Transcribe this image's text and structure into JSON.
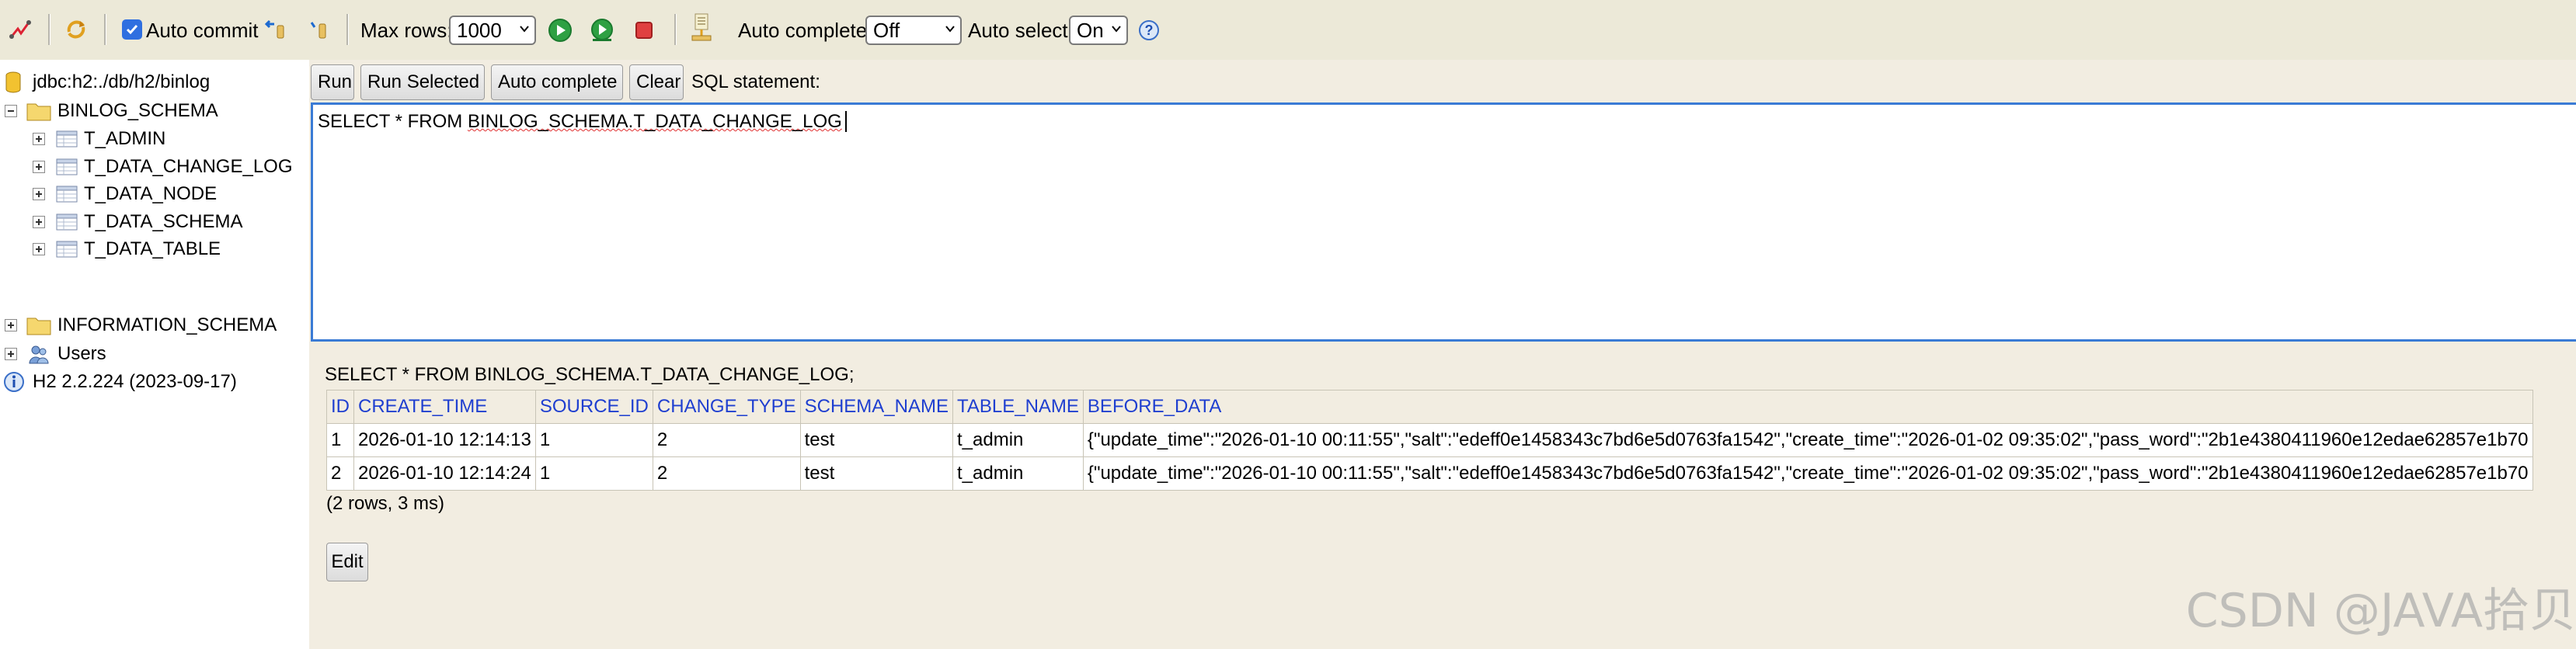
{
  "toolbar": {
    "auto_commit_label": "Auto commit",
    "auto_commit_checked": true,
    "max_rows_label": "Max rows:",
    "max_rows_value": "1000",
    "auto_complete_label": "Auto complete",
    "auto_complete_value": "Off",
    "auto_select_label": "Auto select",
    "auto_select_value": "On",
    "icons": [
      "disconnect-icon",
      "refresh-icon",
      "rollback-icon",
      "commit-icon",
      "run-icon",
      "run-selected-icon",
      "stop-icon",
      "history-icon",
      "help-icon"
    ]
  },
  "tree": {
    "connection": "jdbc:h2:./db/h2/binlog",
    "schema": "BINLOG_SCHEMA",
    "tables": [
      "T_ADMIN",
      "T_DATA_CHANGE_LOG",
      "T_DATA_NODE",
      "T_DATA_SCHEMA",
      "T_DATA_TABLE"
    ],
    "info_schema": "INFORMATION_SCHEMA",
    "users": "Users",
    "version": "H2 2.2.224 (2023-09-17)"
  },
  "actions": {
    "run": "Run",
    "run_selected": "Run Selected",
    "auto_complete": "Auto complete",
    "clear": "Clear",
    "sql_statement_label": "SQL statement:"
  },
  "editor": {
    "prefix": "SELECT * FROM ",
    "table_ref": "BINLOG_SCHEMA.T_DATA_CHANGE_LOG"
  },
  "result": {
    "query": "SELECT * FROM BINLOG_SCHEMA.T_DATA_CHANGE_LOG;",
    "columns": [
      "ID",
      "CREATE_TIME",
      "SOURCE_ID",
      "CHANGE_TYPE",
      "SCHEMA_NAME",
      "TABLE_NAME",
      "BEFORE_DATA"
    ],
    "rows": [
      [
        "1",
        "2026-01-10 12:14:13",
        "1",
        "2",
        "test",
        "t_admin",
        "{\"update_time\":\"2026-01-10 00:11:55\",\"salt\":\"edeff0e1458343c7bd6e5d0763fa1542\",\"create_time\":\"2026-01-02 09:35:02\",\"pass_word\":\"2b1e4380411960e12edae62857e1b70"
      ],
      [
        "2",
        "2026-01-10 12:14:24",
        "1",
        "2",
        "test",
        "t_admin",
        "{\"update_time\":\"2026-01-10 00:11:55\",\"salt\":\"edeff0e1458343c7bd6e5d0763fa1542\",\"create_time\":\"2026-01-02 09:35:02\",\"pass_word\":\"2b1e4380411960e12edae62857e1b70"
      ]
    ],
    "summary": "(2 rows, 3 ms)",
    "edit_label": "Edit"
  },
  "watermark": "CSDN @JAVA拾贝",
  "colors": {
    "toolbar_bg": "#ece9d8",
    "panel_bg": "#f2ede1",
    "editor_border": "#3a7bd5",
    "header_text": "#1f3fd0"
  }
}
